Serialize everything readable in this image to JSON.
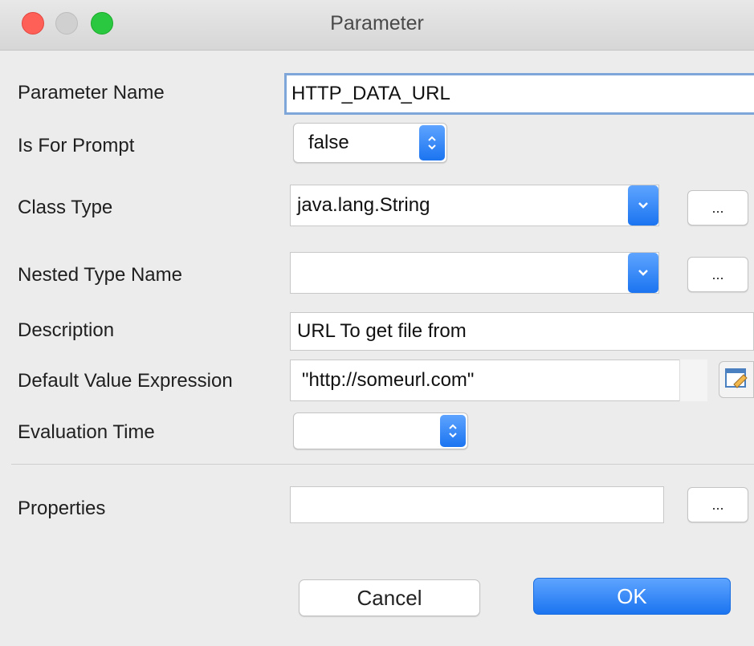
{
  "window": {
    "title": "Parameter"
  },
  "fields": {
    "parameter_name": {
      "label": "Parameter Name",
      "value": "HTTP_DATA_URL"
    },
    "is_for_prompt": {
      "label": "Is For Prompt",
      "value": "false"
    },
    "class_type": {
      "label": "Class Type",
      "value": "java.lang.String",
      "more": "..."
    },
    "nested_type_name": {
      "label": "Nested Type Name",
      "value": "",
      "more": "..."
    },
    "description": {
      "label": "Description",
      "value": "URL To get file from"
    },
    "default_value_expression": {
      "label": "Default Value Expression",
      "value": "\"http://someurl.com\""
    },
    "evaluation_time": {
      "label": "Evaluation Time",
      "value": ""
    },
    "properties": {
      "label": "Properties",
      "value": "",
      "more": "..."
    }
  },
  "buttons": {
    "cancel": "Cancel",
    "ok": "OK"
  },
  "colors": {
    "accent": "#1b74f0",
    "close": "#fe5f57",
    "zoom": "#2ac840"
  },
  "icons": [
    "close-icon",
    "minimize-icon",
    "zoom-icon",
    "updown-chevron-icon",
    "chevron-down-icon",
    "edit-pencil-icon"
  ]
}
